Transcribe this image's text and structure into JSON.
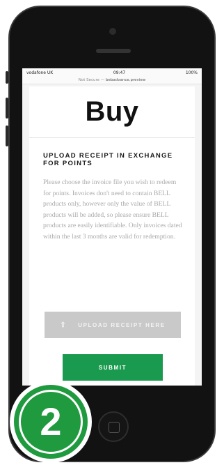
{
  "status_bar": {
    "carrier": "vodafone UK",
    "time": "09:47",
    "battery": "100%"
  },
  "url_bar": {
    "security": "Not Secure —",
    "host": "bebadvance.preview"
  },
  "page": {
    "title": "Buy",
    "subheading": "UPLOAD RECEIPT IN EXCHANGE FOR POINTS",
    "body": "Please choose the invoice file you wish to redeem for points. Invoices don't need to contain BELL products only, however only the value of BELL products will be added, so please ensure BELL products are easily identifiable. Only invoices dated within the last 3 months are valid for redemption.",
    "upload_label": "UPLOAD RECEIPT HERE",
    "submit_label": "SUBMIT"
  },
  "step_badge": {
    "number": "2"
  },
  "colors": {
    "submit": "#1a9a4f",
    "badge": "#1f9a3e",
    "upload_disabled": "#c9c9c9"
  },
  "icons": {
    "upload": "upload-icon",
    "home": "home-button-icon"
  }
}
